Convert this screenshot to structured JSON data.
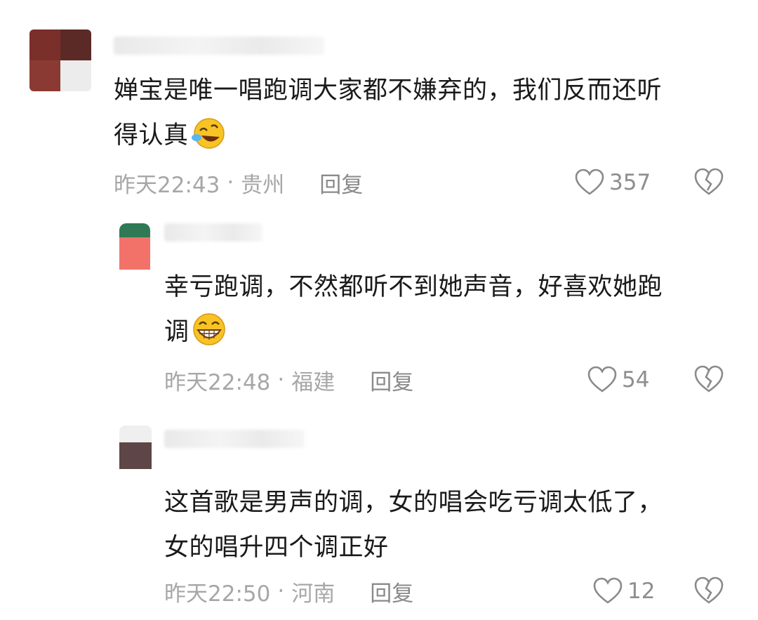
{
  "comments": [
    {
      "text_line1": "婵宝是唯一唱跑调大家都不嫌弃的，我们反而还听",
      "text_line2": "得认真",
      "time": "昨天22:43",
      "location": "贵州",
      "reply_label": "回复",
      "likes": "357",
      "emoji": "rolling-laughing-emoji"
    },
    {
      "text_line1": "幸亏跑调，不然都听不到她声音，好喜欢她跑",
      "text_line2": "调",
      "time": "昨天22:48",
      "location": "福建",
      "reply_label": "回复",
      "likes": "54",
      "emoji": "grinning-emoji"
    },
    {
      "text_line1": "这首歌是男声的调，女的唱会吃亏调太低了，",
      "text_line2": "女的唱升四个调正好",
      "time": "昨天22:50",
      "location": "河南",
      "reply_label": "回复",
      "likes": "12"
    }
  ],
  "meta_separator": "·",
  "icons": {
    "like": "heart-outline-icon",
    "dislike": "broken-heart-icon"
  }
}
